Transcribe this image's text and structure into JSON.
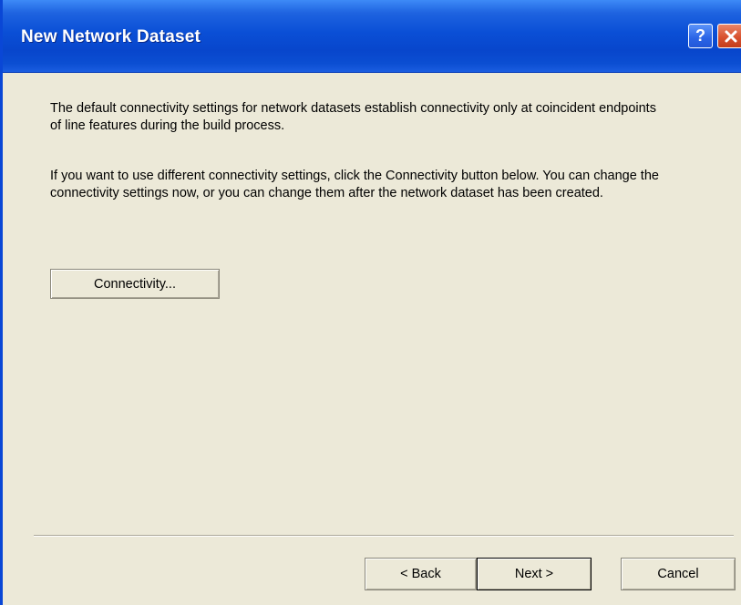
{
  "window": {
    "title": "New Network Dataset",
    "help_label": "?",
    "close_icon": "close-icon"
  },
  "body": {
    "paragraph1": "The default connectivity settings for network datasets establish connectivity only at coincident endpoints of line features during the build process.",
    "paragraph2": "If you want to use different connectivity settings, click the Connectivity button below.  You can change the connectivity settings now, or you can change them after the network dataset has been created.",
    "connectivity_button": "Connectivity..."
  },
  "footer": {
    "back_label": "< Back",
    "next_label": "Next >",
    "cancel_label": "Cancel"
  },
  "colors": {
    "titlebar": "#0a4fd6",
    "dialog_background": "#ece9d8",
    "close_button": "#d9522f"
  }
}
